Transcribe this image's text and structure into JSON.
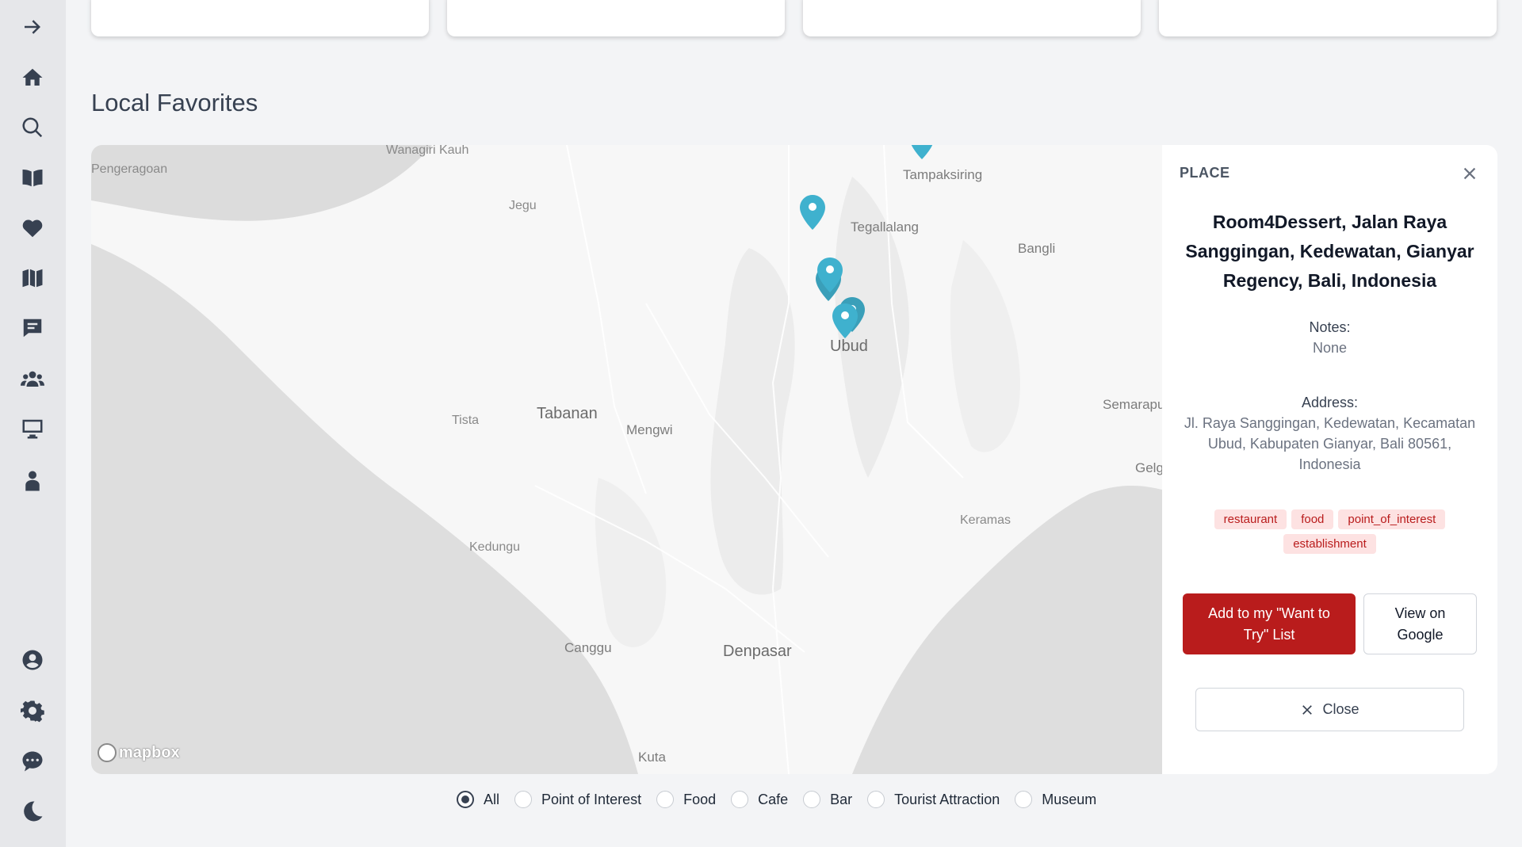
{
  "sidebar": {
    "toggle_icon": "arrow-right-icon",
    "items": [
      {
        "name": "home",
        "icon": "home-icon"
      },
      {
        "name": "search",
        "icon": "search-icon"
      },
      {
        "name": "guides",
        "icon": "book-icon"
      },
      {
        "name": "favorites",
        "icon": "heart-icon"
      },
      {
        "name": "map",
        "icon": "map-icon"
      },
      {
        "name": "messages",
        "icon": "message-icon"
      },
      {
        "name": "community",
        "icon": "users-icon"
      },
      {
        "name": "desktop",
        "icon": "monitor-icon"
      },
      {
        "name": "profile-alt",
        "icon": "person-icon"
      }
    ],
    "bottom_items": [
      {
        "name": "account",
        "icon": "user-circle-icon"
      },
      {
        "name": "settings",
        "icon": "gear-icon"
      },
      {
        "name": "chat",
        "icon": "chat-bubble-icon"
      },
      {
        "name": "theme",
        "icon": "moon-icon"
      }
    ]
  },
  "section": {
    "title": "Local Favorites"
  },
  "map": {
    "attribution": "mapbox",
    "labels": [
      "Wanagiri Kauh",
      "Pengeragoan",
      "Jegu",
      "Tampaksiring",
      "Tegallalang",
      "Bangli",
      "Ubud",
      "Tabanan",
      "Tista",
      "Mengwi",
      "Semarapu",
      "Gelg",
      "Keramas",
      "Kedungu",
      "Canggu",
      "Denpasar",
      "Kuta"
    ],
    "marker_color": "#3fb1ce"
  },
  "panel": {
    "heading": "PLACE",
    "place_name": "Room4Dessert, Jalan Raya Sanggingan, Kedewatan, Gianyar Regency, Bali, Indonesia",
    "notes_label": "Notes:",
    "notes_value": "None",
    "address_label": "Address:",
    "address_value": "Jl. Raya Sanggingan, Kedewatan, Kecamatan Ubud, Kabupaten Gianyar, Bali 80561, Indonesia",
    "tags": [
      "restaurant",
      "food",
      "point_of_interest",
      "establishment"
    ],
    "add_button": "Add to my \"Want to Try\" List",
    "google_button": "View on Google",
    "close_button": "Close"
  },
  "filters": {
    "options": [
      "All",
      "Point of Interest",
      "Food",
      "Cafe",
      "Bar",
      "Tourist Attraction",
      "Museum"
    ],
    "selected": "All"
  },
  "colors": {
    "accent": "#b91c1c",
    "tag_bg": "#fde2e2",
    "sidebar_bg": "#e6e7ea"
  }
}
